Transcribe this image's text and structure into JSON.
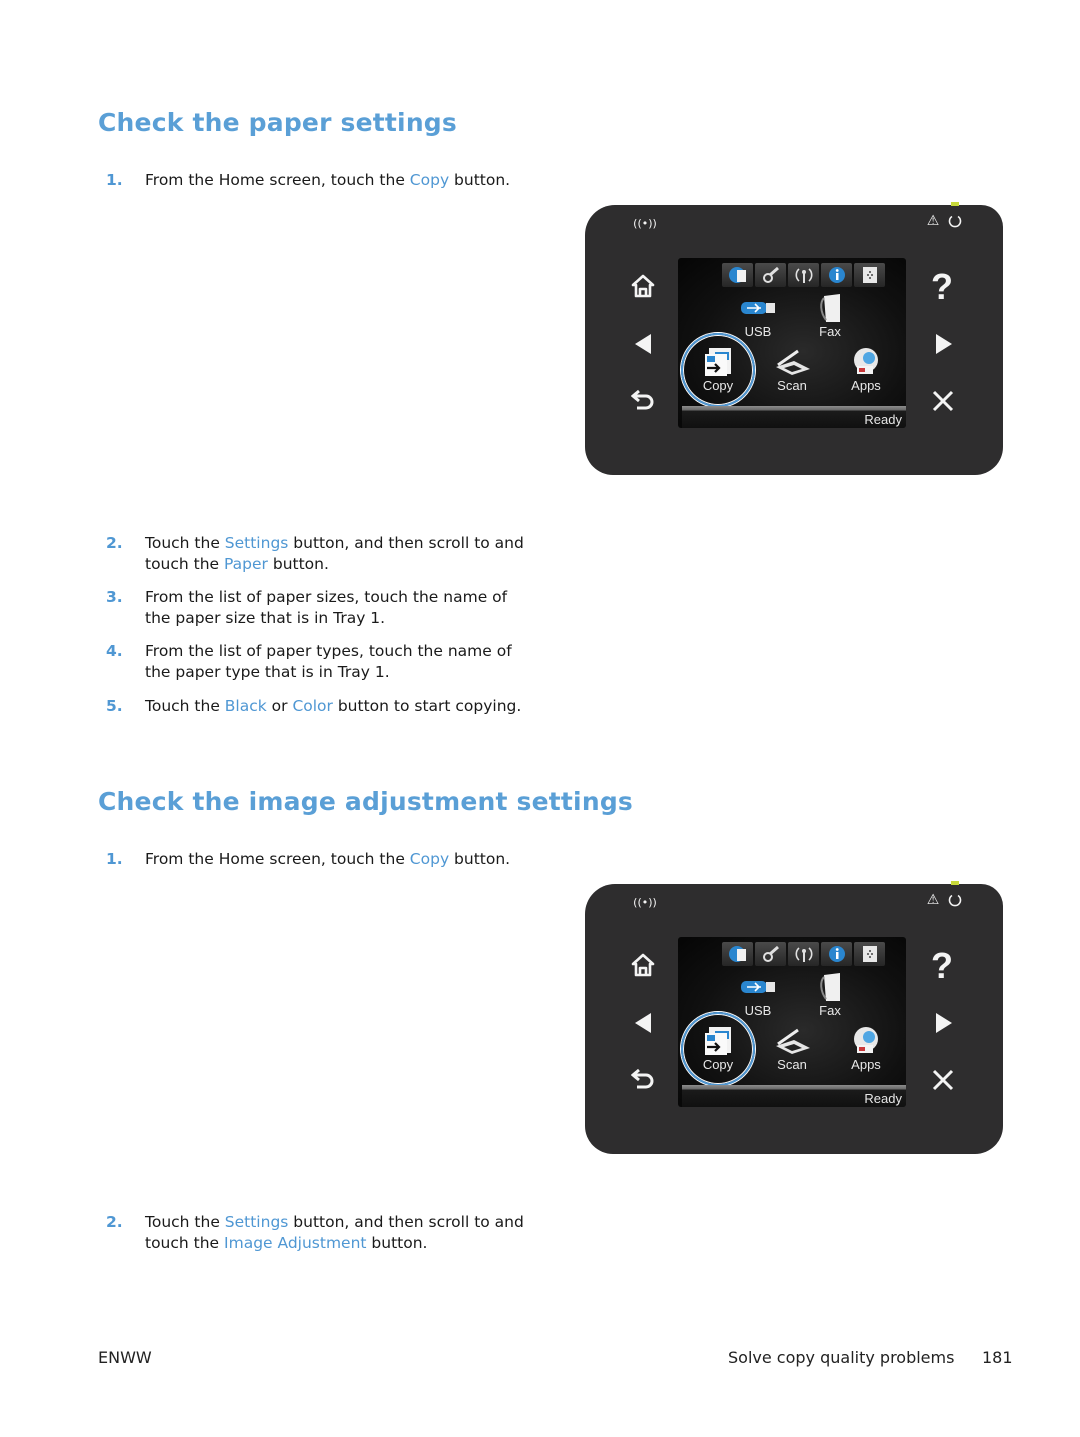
{
  "section1": {
    "title": "Check the paper settings",
    "steps": [
      {
        "num": "1.",
        "parts": [
          "From the Home screen, touch the ",
          "Copy",
          " button."
        ]
      },
      {
        "num": "2.",
        "parts": [
          "Touch the ",
          "Settings",
          " button, and then scroll to and touch the ",
          "Paper",
          " button."
        ]
      },
      {
        "num": "3.",
        "parts": [
          "From the list of paper sizes, touch the name of the paper size that is in Tray 1."
        ]
      },
      {
        "num": "4.",
        "parts": [
          "From the list of paper types, touch the name of the paper type that is in Tray 1."
        ]
      },
      {
        "num": "5.",
        "parts": [
          "Touch the ",
          "Black",
          " or ",
          "Color",
          " button to start copying."
        ]
      }
    ]
  },
  "section2": {
    "title": "Check the image adjustment settings",
    "steps": [
      {
        "num": "1.",
        "parts": [
          "From the Home screen, touch the ",
          "Copy",
          " button."
        ]
      },
      {
        "num": "2.",
        "parts": [
          "Touch the ",
          "Settings",
          " button, and then scroll to and touch the ",
          "Image Adjustment",
          " button."
        ]
      }
    ]
  },
  "panel": {
    "top_icons": [
      "wireless-icon",
      "warning-icon",
      "power-icon"
    ],
    "side_left": [
      "home-icon",
      "back-arrow-icon",
      "return-icon"
    ],
    "side_right": [
      "help-icon",
      "forward-arrow-icon",
      "cancel-icon"
    ],
    "toolbar": [
      "web-services-icon",
      "setup-icon",
      "wireless-icon",
      "information-icon",
      "supplies-icon"
    ],
    "apps": {
      "usb": "USB",
      "fax": "Fax",
      "copy": "Copy",
      "scan": "Scan",
      "apps": "Apps"
    },
    "status": "Ready",
    "highlighted_app": "Copy",
    "help_glyph": "?",
    "warning_glyph": "⚠"
  },
  "footer": {
    "left": "ENWW",
    "chapter": "Solve copy quality problems",
    "page": "181"
  },
  "colors": {
    "accent": "#4f97d3",
    "heading": "#5a9fd6",
    "panel": "#2e2d2e",
    "led": "#c7d93a"
  }
}
